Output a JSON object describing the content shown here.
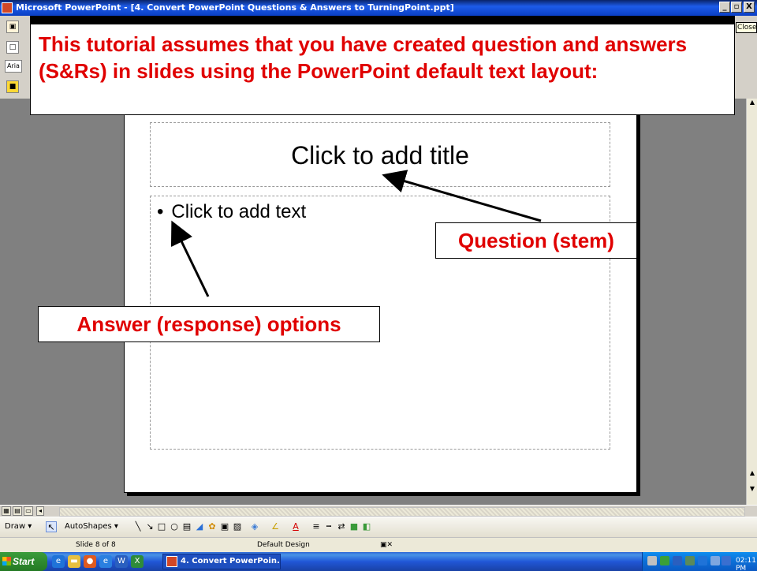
{
  "window": {
    "title": "Microsoft PowerPoint - [4. Convert PowerPoint Questions & Answers to TurningPoint.ppt]",
    "minimize": "_",
    "restore": "\u0000",
    "close": "X",
    "close_tooltip": "Close"
  },
  "toolbar_left": {
    "font_fragment": "Aria"
  },
  "callouts": {
    "intro": "This tutorial assumes that you have created question and answers (S&Rs) in slides using the PowerPoint default text layout:",
    "question": "Question (stem)",
    "answer": "Answer (response) options"
  },
  "slide": {
    "title_placeholder": "Click to add title",
    "body_bullet": "•",
    "body_placeholder": "Click to add text"
  },
  "draw_toolbar": {
    "draw_label": "Draw",
    "autoshapes_label": "AutoShapes"
  },
  "status": {
    "slide_counter": "Slide 8 of 8",
    "design": "Default Design"
  },
  "taskbar": {
    "start_label": "Start",
    "task_label": "4. Convert PowerPoin...",
    "clock": "02:11 PM"
  },
  "icons": [
    "powerpoint-app-icon",
    "new-doc-icon",
    "arrow-cursor-icon",
    "line-icon",
    "rectangle-icon",
    "oval-icon",
    "fill-color-icon",
    "font-color-icon",
    "windows-flag-icon"
  ]
}
